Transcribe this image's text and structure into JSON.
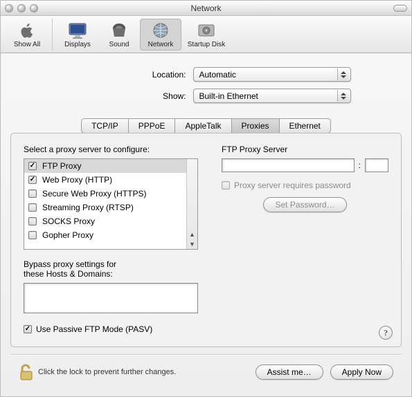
{
  "window": {
    "title": "Network"
  },
  "toolbar": {
    "showAll": "Show All",
    "displays": "Displays",
    "sound": "Sound",
    "network": "Network",
    "startup": "Startup Disk"
  },
  "form": {
    "locationLabel": "Location:",
    "locationValue": "Automatic",
    "showLabel": "Show:",
    "showValue": "Built-in Ethernet"
  },
  "tabs": [
    "TCP/IP",
    "PPPoE",
    "AppleTalk",
    "Proxies",
    "Ethernet"
  ],
  "activeTabIndex": 3,
  "proxies": {
    "selectLabel": "Select a proxy server to configure:",
    "items": [
      {
        "label": "FTP Proxy",
        "checked": true,
        "selected": true
      },
      {
        "label": "Web Proxy (HTTP)",
        "checked": true,
        "selected": false
      },
      {
        "label": "Secure Web Proxy (HTTPS)",
        "checked": false,
        "selected": false
      },
      {
        "label": "Streaming Proxy (RTSP)",
        "checked": false,
        "selected": false
      },
      {
        "label": "SOCKS Proxy",
        "checked": false,
        "selected": false
      },
      {
        "label": "Gopher Proxy",
        "checked": false,
        "selected": false
      }
    ],
    "rightTitle": "FTP Proxy Server",
    "host": "",
    "portSep": ":",
    "port": "",
    "requiresPwLabel": "Proxy server requires password",
    "requiresPwChecked": false,
    "setPwLabel": "Set Password…",
    "bypassLabel1": "Bypass proxy settings for",
    "bypassLabel2": "these Hosts & Domains:",
    "bypassValue": "",
    "pasvLabel": "Use Passive FTP Mode (PASV)",
    "pasvChecked": true
  },
  "footer": {
    "lockText": "Click the lock to prevent further changes.",
    "assist": "Assist me…",
    "apply": "Apply Now"
  }
}
